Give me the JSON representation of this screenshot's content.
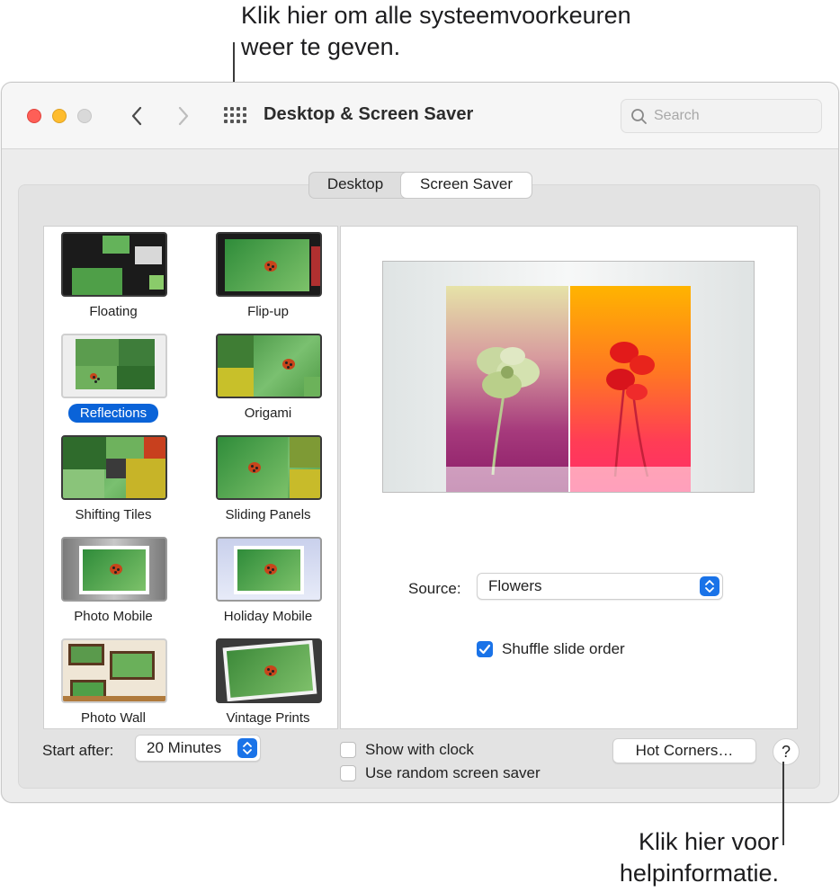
{
  "callouts": {
    "top_line1": "Klik hier om alle systeemvoorkeuren",
    "top_line2": "weer te geven.",
    "bottom_line1": "Klik hier voor",
    "bottom_line2": "helpinformatie."
  },
  "window": {
    "title": "Desktop & Screen Saver",
    "search_placeholder": "Search"
  },
  "tabs": [
    {
      "label": "Desktop",
      "selected": false
    },
    {
      "label": "Screen Saver",
      "selected": true
    }
  ],
  "screensavers": [
    {
      "label": "Floating",
      "selected": false
    },
    {
      "label": "Flip-up",
      "selected": false
    },
    {
      "label": "Reflections",
      "selected": true
    },
    {
      "label": "Origami",
      "selected": false
    },
    {
      "label": "Shifting Tiles",
      "selected": false
    },
    {
      "label": "Sliding Panels",
      "selected": false
    },
    {
      "label": "Photo Mobile",
      "selected": false
    },
    {
      "label": "Holiday Mobile",
      "selected": false
    },
    {
      "label": "Photo Wall",
      "selected": false
    },
    {
      "label": "Vintage Prints",
      "selected": false
    }
  ],
  "options": {
    "source_label": "Source:",
    "source_value": "Flowers",
    "shuffle_label": "Shuffle slide order",
    "shuffle_checked": true
  },
  "footer": {
    "start_after_label": "Start after:",
    "start_after_value": "20 Minutes",
    "show_clock_label": "Show with clock",
    "show_clock_checked": false,
    "random_label": "Use random screen saver",
    "random_checked": false,
    "hot_corners_label": "Hot Corners…",
    "help_label": "?"
  },
  "colors": {
    "accent": "#1a73e8",
    "selection": "#0a63d8",
    "close": "#fe5f57",
    "minimize": "#febc2e"
  }
}
